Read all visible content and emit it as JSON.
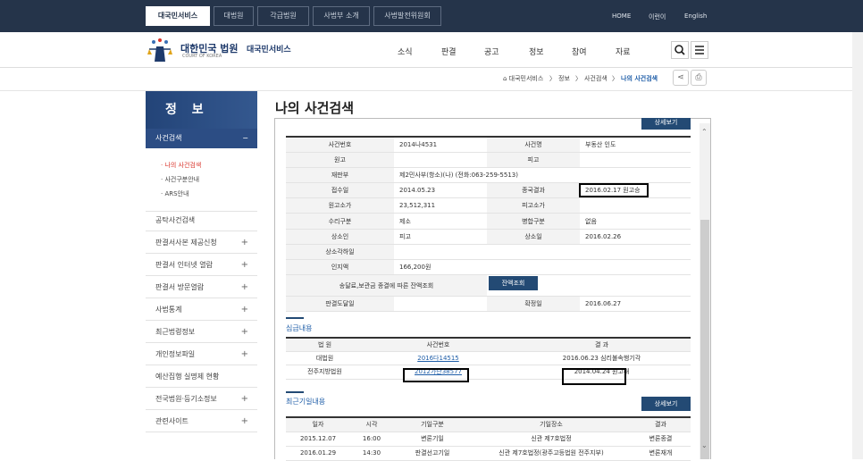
{
  "topbar": {
    "tabs": [
      "대국민서비스",
      "대법원",
      "각급법원",
      "사법부 소개",
      "사법발전위원회"
    ],
    "links": [
      "HOME",
      "이런이",
      "English"
    ]
  },
  "header": {
    "logo_text": "대한민국 법원",
    "logo_sub": "COURT OF KOREA",
    "service": "대국민서비스",
    "menu": [
      "소식",
      "판결",
      "공고",
      "정보",
      "참여",
      "자료"
    ]
  },
  "breadcrumb": [
    "대국민서비스",
    "정보",
    "사건검색",
    "나의 사건검색"
  ],
  "sidebar": {
    "title": "정 보",
    "selected": "사건검색",
    "selected_mark": "−",
    "subs": [
      "· 나의 사건검색",
      "· 사건구분안내",
      "· ARS안내"
    ],
    "items": [
      {
        "label": "공탁사건검색",
        "plus": ""
      },
      {
        "label": "판결서사본 제공신청",
        "plus": "+"
      },
      {
        "label": "판결서 인터넷 열람",
        "plus": "+"
      },
      {
        "label": "판결서 방문열람",
        "plus": "+"
      },
      {
        "label": "사법통계",
        "plus": "+"
      },
      {
        "label": "최근법령정보",
        "plus": "+"
      },
      {
        "label": "개인정보파일",
        "plus": "+"
      },
      {
        "label": "예산집행 실명제 현황",
        "plus": ""
      },
      {
        "label": "전국법원·등기소정보",
        "plus": "+"
      },
      {
        "label": "관련사이트",
        "plus": "+"
      }
    ]
  },
  "page_title": "나의 사건검색",
  "partial_button": "상세보기",
  "case": {
    "r1": [
      "사건번호",
      "2014나4531",
      "사건명",
      "부동산 인도"
    ],
    "r2": [
      "원고",
      "",
      "피고",
      ""
    ],
    "r3": [
      "재판부",
      "제2민사부(항소)(나) (전화:063-259-5513)"
    ],
    "r4": [
      "접수일",
      "2014.05.23",
      "종국결과",
      "2016.02.17 원고승"
    ],
    "r5": [
      "원고소가",
      "23,512,311",
      "피고소가",
      ""
    ],
    "r6": [
      "수리구분",
      "제소",
      "병합구분",
      "없음"
    ],
    "r7": [
      "상소인",
      "피고",
      "상소일",
      "2016.02.26"
    ],
    "r8": [
      "상소각하일",
      ""
    ],
    "r9": [
      "인지액",
      "166,200원"
    ],
    "r10": [
      "송달료,보관금 종결에 따른 잔액조회",
      "잔액조회"
    ],
    "r11": [
      "판결도달일",
      "",
      "확정일",
      "2016.06.27"
    ]
  },
  "lower": {
    "title": "심급내용",
    "headers": [
      "법 원",
      "사건번호",
      "결 과"
    ],
    "rows": [
      [
        "대법원",
        "2016다14515",
        "2016.06.23 심리불속행기각"
      ],
      [
        "전주지방법원",
        "2012가단38577",
        "2014.04.24 원고패"
      ]
    ]
  },
  "dates": {
    "title": "최근기일내용",
    "button": "상세보기",
    "headers": [
      "일자",
      "시각",
      "기일구분",
      "기일장소",
      "결과"
    ],
    "rows": [
      [
        "2015.12.07",
        "16:00",
        "변론기일",
        "신관 제7호법정",
        "변론종결"
      ],
      [
        "2016.01.29",
        "14:30",
        "판결선고기일",
        "신관 제7호법정(광주고등법원 전주지부)",
        "변론재개"
      ]
    ]
  }
}
